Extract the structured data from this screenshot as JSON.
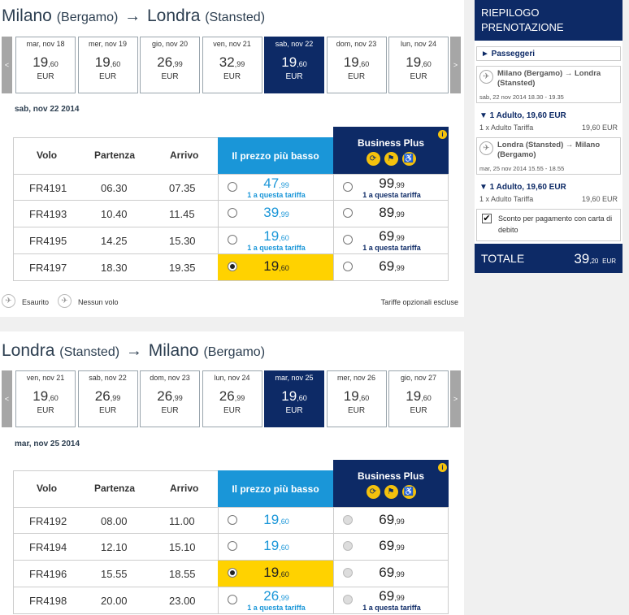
{
  "outbound": {
    "route": {
      "from_city": "Milano",
      "from_airport": "(Bergamo)",
      "arrow": "→",
      "to_city": "Londra",
      "to_airport": "(Stansted)"
    },
    "dates": [
      {
        "label": "mar, nov 18",
        "price": "19",
        "cents": ",60",
        "currency": "EUR",
        "selected": false
      },
      {
        "label": "mer, nov 19",
        "price": "19",
        "cents": ",60",
        "currency": "EUR",
        "selected": false
      },
      {
        "label": "gio, nov 20",
        "price": "26",
        "cents": ",99",
        "currency": "EUR",
        "selected": false
      },
      {
        "label": "ven, nov 21",
        "price": "32",
        "cents": ",99",
        "currency": "EUR",
        "selected": false
      },
      {
        "label": "sab, nov 22",
        "price": "19",
        "cents": ",60",
        "currency": "EUR",
        "selected": true
      },
      {
        "label": "dom, nov 23",
        "price": "19",
        "cents": ",60",
        "currency": "EUR",
        "selected": false
      },
      {
        "label": "lun, nov 24",
        "price": "19",
        "cents": ",60",
        "currency": "EUR",
        "selected": false
      }
    ],
    "selected_date": "sab, nov 22 2014",
    "flights": [
      {
        "flight": "FR4191",
        "dep": "06.30",
        "arr": "07.35",
        "low_price": "47",
        "low_cents": ",99",
        "low_note": "1 a questa tariffa",
        "low_checked": false,
        "bp_price": "99",
        "bp_cents": ",99",
        "bp_note": "1 a questa tariffa",
        "bp_disabled": false
      },
      {
        "flight": "FR4193",
        "dep": "10.40",
        "arr": "11.45",
        "low_price": "39",
        "low_cents": ",99",
        "low_note": "",
        "low_checked": false,
        "bp_price": "89",
        "bp_cents": ",99",
        "bp_note": "",
        "bp_disabled": false
      },
      {
        "flight": "FR4195",
        "dep": "14.25",
        "arr": "15.30",
        "low_price": "19",
        "low_cents": ",60",
        "low_note": "1 a questa tariffa",
        "low_checked": false,
        "bp_price": "69",
        "bp_cents": ",99",
        "bp_note": "1 a questa tariffa",
        "bp_disabled": false
      },
      {
        "flight": "FR4197",
        "dep": "18.30",
        "arr": "19.35",
        "low_price": "19",
        "low_cents": ",60",
        "low_note": "",
        "low_checked": true,
        "bp_price": "69",
        "bp_cents": ",99",
        "bp_note": "",
        "bp_disabled": false
      }
    ]
  },
  "inbound": {
    "route": {
      "from_city": "Londra",
      "from_airport": "(Stansted)",
      "arrow": "→",
      "to_city": "Milano",
      "to_airport": "(Bergamo)"
    },
    "dates": [
      {
        "label": "ven, nov 21",
        "price": "19",
        "cents": ",60",
        "currency": "EUR",
        "selected": false
      },
      {
        "label": "sab, nov 22",
        "price": "26",
        "cents": ",99",
        "currency": "EUR",
        "selected": false
      },
      {
        "label": "dom, nov 23",
        "price": "26",
        "cents": ",99",
        "currency": "EUR",
        "selected": false
      },
      {
        "label": "lun, nov 24",
        "price": "26",
        "cents": ",99",
        "currency": "EUR",
        "selected": false
      },
      {
        "label": "mar, nov 25",
        "price": "19",
        "cents": ",60",
        "currency": "EUR",
        "selected": true
      },
      {
        "label": "mer, nov 26",
        "price": "19",
        "cents": ",60",
        "currency": "EUR",
        "selected": false
      },
      {
        "label": "gio, nov 27",
        "price": "19",
        "cents": ",60",
        "currency": "EUR",
        "selected": false
      }
    ],
    "selected_date": "mar, nov 25 2014",
    "flights": [
      {
        "flight": "FR4192",
        "dep": "08.00",
        "arr": "11.00",
        "low_price": "19",
        "low_cents": ",60",
        "low_note": "",
        "low_checked": false,
        "bp_price": "69",
        "bp_cents": ",99",
        "bp_note": "",
        "bp_disabled": true
      },
      {
        "flight": "FR4194",
        "dep": "12.10",
        "arr": "15.10",
        "low_price": "19",
        "low_cents": ",60",
        "low_note": "",
        "low_checked": false,
        "bp_price": "69",
        "bp_cents": ",99",
        "bp_note": "",
        "bp_disabled": true
      },
      {
        "flight": "FR4196",
        "dep": "15.55",
        "arr": "18.55",
        "low_price": "19",
        "low_cents": ",60",
        "low_note": "",
        "low_checked": true,
        "bp_price": "69",
        "bp_cents": ",99",
        "bp_note": "",
        "bp_disabled": true
      },
      {
        "flight": "FR4198",
        "dep": "20.00",
        "arr": "23.00",
        "low_price": "26",
        "low_cents": ",99",
        "low_note": "1 a questa tariffa",
        "low_checked": false,
        "bp_price": "69",
        "bp_cents": ",99",
        "bp_note": "1 a questa tariffa",
        "bp_disabled": true
      }
    ]
  },
  "table_headers": {
    "flight": "Volo",
    "departure": "Partenza",
    "arrival": "Arrivo",
    "lowest": "Il prezzo più basso",
    "business_plus": "Business Plus",
    "info_icon": "i"
  },
  "nav": {
    "prev": "<",
    "next": ">"
  },
  "legend": {
    "sold_out": "Esaurito",
    "no_flight": "Nessun volo",
    "optional": "Tariffe opzionali escluse"
  },
  "sidebar": {
    "title_line1": "RIEPILOGO",
    "title_line2": "PRENOTAZIONE",
    "passengers": "► Passeggeri",
    "leg1_route": "Milano (Bergamo) → Londra (Stansted)",
    "leg1_time": "sab, 22 nov 2014 18.30 - 19.35",
    "leg1_adult": "▼ 1 Adulto, 19,60 EUR",
    "leg1_tariff": "1 x Adulto Tariffa",
    "leg1_amount": "19,60 EUR",
    "leg2_route": "Londra (Stansted) → Milano (Bergamo)",
    "leg2_time": "mar, 25 nov 2014 15.55 - 18.55",
    "leg2_adult": "▼ 1 Adulto, 19,60 EUR",
    "leg2_tariff": "1 x Adulto Tariffa",
    "leg2_amount": "19,60 EUR",
    "discount": "Sconto per pagamento con carta di debito",
    "total_label": "TOTALE",
    "total_value": "39",
    "total_cents": ",20",
    "total_currency": "EUR"
  },
  "colors": {
    "navy": "#0d2a66",
    "blue": "#1a96d8",
    "yellow": "#ffd200"
  },
  "icons": {
    "plane": "plane-icon",
    "sold_out": "sold-out-icon",
    "no_flight": "no-flight-icon"
  }
}
